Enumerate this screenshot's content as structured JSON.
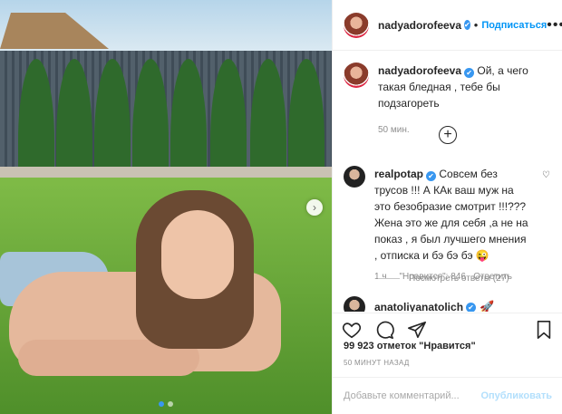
{
  "post": {
    "username": "nadyadorofeeva",
    "follow_label": "Подписаться",
    "bullet": "•",
    "more_label": "•••",
    "caption": "Ой, а чего такая бледная , тебе бы подзагореть",
    "caption_time": "50 мин.",
    "verified_mark": "✔"
  },
  "comments": [
    {
      "username": "realpotap",
      "text": "Совсем без трусов !!! А КАк ваш муж на это безобразие смотрит !!!??? Жена это же для себя ,а не на показ , я был лучшего мнения , отписка и бэ бэ бэ 😜",
      "time": "1 ч.",
      "likes": "\"Нравится\": 846",
      "reply_label": "Ответить",
      "view_replies": "Посмотреть ответы (27)"
    },
    {
      "username": "anatoliyanatolich",
      "emoji": "🚀"
    }
  ],
  "engagement": {
    "likes_text": "99 923 отметок \"Нравится\"",
    "time_ago": "50 МИНУТ НАЗАД"
  },
  "comment_box": {
    "placeholder": "Добавьте комментарий...",
    "publish_label": "Опубликовать"
  },
  "icons": {
    "heart": "heart-icon",
    "comment": "comment-icon",
    "share": "share-icon",
    "bookmark": "bookmark-icon",
    "add": "plus-circle-icon",
    "next": "chevron-right-icon"
  },
  "colors": {
    "link_blue": "#0095f6",
    "publish_disabled": "#b2dffc",
    "muted": "#8e8e8e"
  },
  "carousel": {
    "total": 2,
    "active": 1
  }
}
